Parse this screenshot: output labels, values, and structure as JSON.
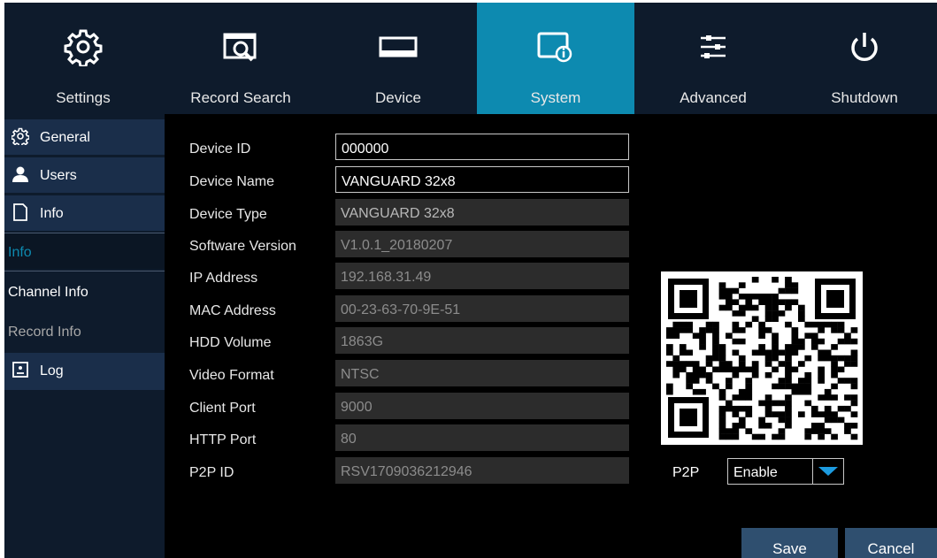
{
  "nav": {
    "tabs": [
      {
        "label": "Settings",
        "icon": "gear-icon"
      },
      {
        "label": "Record Search",
        "icon": "record-search-icon"
      },
      {
        "label": "Device",
        "icon": "hard-drive-icon"
      },
      {
        "label": "System",
        "icon": "system-info-icon"
      },
      {
        "label": "Advanced",
        "icon": "sliders-icon"
      },
      {
        "label": "Shutdown",
        "icon": "power-icon"
      }
    ],
    "active": "System"
  },
  "sidebar": {
    "items": [
      {
        "label": "General",
        "icon": "gear-icon"
      },
      {
        "label": "Users",
        "icon": "user-icon"
      },
      {
        "label": "Info",
        "icon": "document-icon"
      },
      {
        "label": "Info"
      },
      {
        "label": "Channel Info"
      },
      {
        "label": "Record Info"
      },
      {
        "label": "Log",
        "icon": "log-icon"
      }
    ]
  },
  "info": {
    "fields": [
      {
        "label": "Device ID",
        "value": "000000"
      },
      {
        "label": "Device Name",
        "value": "VANGUARD 32x8"
      },
      {
        "label": "Device Type",
        "value": "VANGUARD 32x8"
      },
      {
        "label": "Software Version",
        "value": "V1.0.1_20180207"
      },
      {
        "label": "IP Address",
        "value": "192.168.31.49"
      },
      {
        "label": "MAC Address",
        "value": "00-23-63-70-9E-51"
      },
      {
        "label": "HDD Volume",
        "value": "1863G"
      },
      {
        "label": "Video Format",
        "value": "NTSC"
      },
      {
        "label": "Client Port",
        "value": "9000"
      },
      {
        "label": "HTTP Port",
        "value": "80"
      },
      {
        "label": "P2P ID",
        "value": "RSV1709036212946"
      }
    ]
  },
  "p2p": {
    "label": "P2P",
    "value": "Enable"
  },
  "buttons": {
    "save": "Save",
    "cancel": "Cancel"
  },
  "colors": {
    "active_tab": "#0d8ab0",
    "nav_bg": "#0e1b2c",
    "sidebar_active_text": "#0d8ab0",
    "dropdown_arrow": "#1c9be0"
  }
}
